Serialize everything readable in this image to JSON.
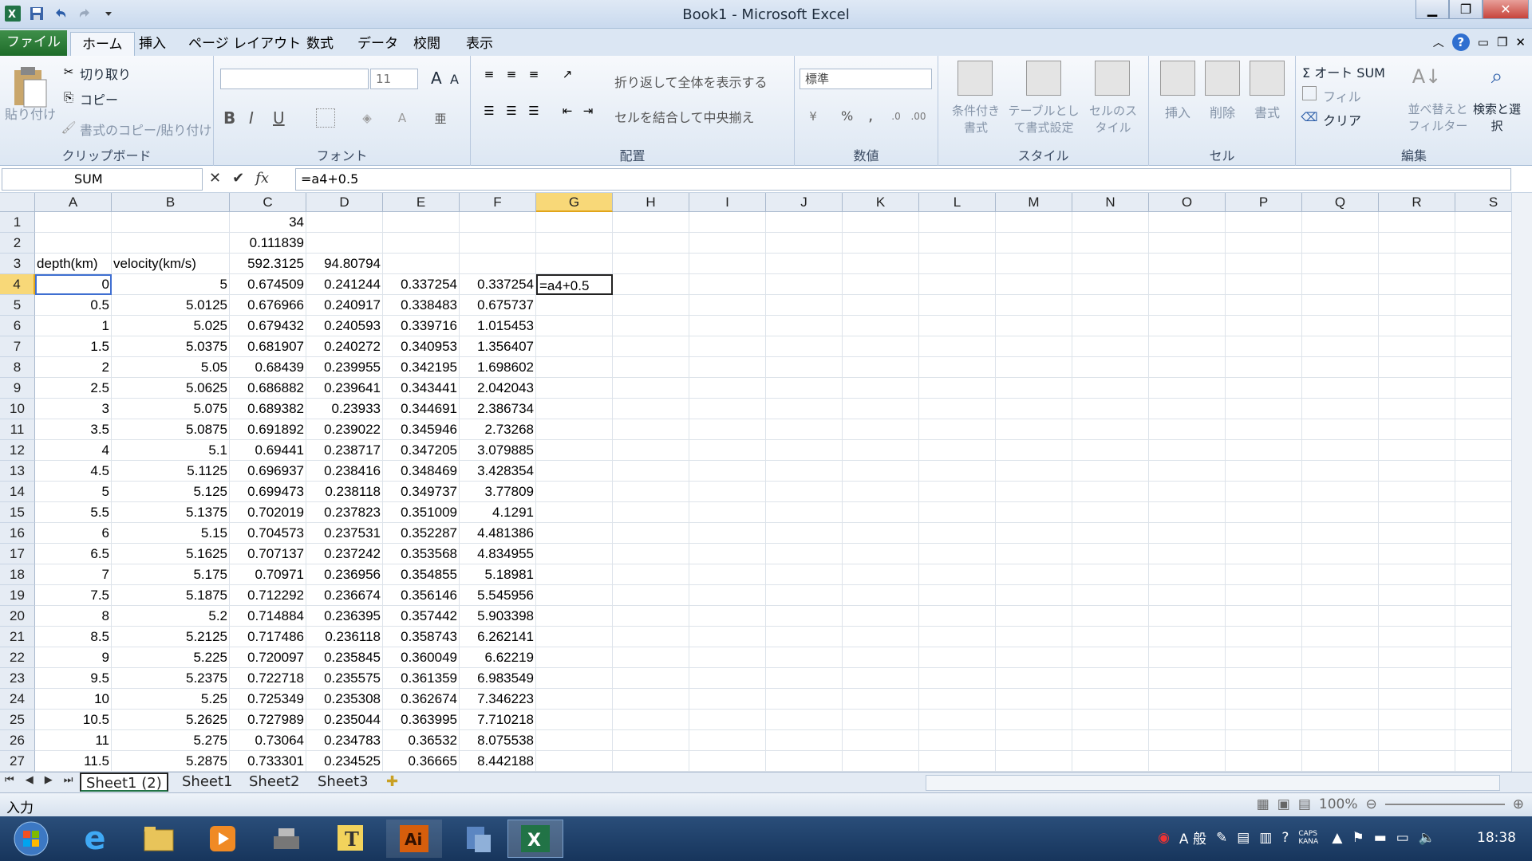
{
  "window": {
    "title": "Book1 - Microsoft Excel"
  },
  "tabs": [
    "ファイル",
    "ホーム",
    "挿入",
    "ページ レイアウト",
    "数式",
    "データ",
    "校閲",
    "表示"
  ],
  "ribbon": {
    "clipboard": {
      "paste": "貼り付け",
      "cut": "切り取り",
      "copy": "コピー",
      "format_painter": "書式のコピー/貼り付け",
      "label": "クリップボード"
    },
    "font": {
      "font_name": "",
      "font_size": "11",
      "bold": "B",
      "italic": "I",
      "underline": "U",
      "label": "フォント"
    },
    "alignment": {
      "wrap": "折り返して全体を表示する",
      "merge": "セルを結合して中央揃え",
      "label": "配置"
    },
    "number": {
      "format": "標準",
      "percent": "%",
      "comma": ",",
      "label": "数値"
    },
    "styles": {
      "conditional": "条件付き書式",
      "table": "テーブルとして書式設定",
      "cell": "セルのスタイル",
      "label": "スタイル"
    },
    "cells": {
      "insert": "挿入",
      "delete": "削除",
      "format": "書式",
      "label": "セル"
    },
    "editing": {
      "autosum": "Σ オート SUM",
      "fill": "フィル",
      "clear": "クリア",
      "sort": "並べ替えとフィルター",
      "find": "検索と選択",
      "label": "編集"
    }
  },
  "formula_bar": {
    "name_box": "SUM",
    "fx": "fx",
    "formula": "=a4+0.5"
  },
  "columns": [
    "A",
    "B",
    "C",
    "D",
    "E",
    "F",
    "G",
    "H",
    "I",
    "J",
    "K",
    "L",
    "M",
    "N",
    "O",
    "P",
    "Q",
    "R",
    "S"
  ],
  "rows": [
    {
      "n": "1",
      "c": [
        "",
        "",
        "34",
        "",
        "",
        "",
        ""
      ]
    },
    {
      "n": "2",
      "c": [
        "",
        "",
        "0.111839",
        "",
        "",
        "",
        ""
      ]
    },
    {
      "n": "3",
      "c": [
        "depth(km)",
        "velocity(km/s)",
        "592.3125",
        "94.80794",
        "",
        "",
        ""
      ]
    },
    {
      "n": "4",
      "c": [
        "0",
        "5",
        "0.674509",
        "0.241244",
        "0.337254",
        "0.337254",
        "=a4+0.5"
      ]
    },
    {
      "n": "5",
      "c": [
        "0.5",
        "5.0125",
        "0.676966",
        "0.240917",
        "0.338483",
        "0.675737",
        ""
      ]
    },
    {
      "n": "6",
      "c": [
        "1",
        "5.025",
        "0.679432",
        "0.240593",
        "0.339716",
        "1.015453",
        ""
      ]
    },
    {
      "n": "7",
      "c": [
        "1.5",
        "5.0375",
        "0.681907",
        "0.240272",
        "0.340953",
        "1.356407",
        ""
      ]
    },
    {
      "n": "8",
      "c": [
        "2",
        "5.05",
        "0.68439",
        "0.239955",
        "0.342195",
        "1.698602",
        ""
      ]
    },
    {
      "n": "9",
      "c": [
        "2.5",
        "5.0625",
        "0.686882",
        "0.239641",
        "0.343441",
        "2.042043",
        ""
      ]
    },
    {
      "n": "10",
      "c": [
        "3",
        "5.075",
        "0.689382",
        "0.23933",
        "0.344691",
        "2.386734",
        ""
      ]
    },
    {
      "n": "11",
      "c": [
        "3.5",
        "5.0875",
        "0.691892",
        "0.239022",
        "0.345946",
        "2.73268",
        ""
      ]
    },
    {
      "n": "12",
      "c": [
        "4",
        "5.1",
        "0.69441",
        "0.238717",
        "0.347205",
        "3.079885",
        ""
      ]
    },
    {
      "n": "13",
      "c": [
        "4.5",
        "5.1125",
        "0.696937",
        "0.238416",
        "0.348469",
        "3.428354",
        ""
      ]
    },
    {
      "n": "14",
      "c": [
        "5",
        "5.125",
        "0.699473",
        "0.238118",
        "0.349737",
        "3.77809",
        ""
      ]
    },
    {
      "n": "15",
      "c": [
        "5.5",
        "5.1375",
        "0.702019",
        "0.237823",
        "0.351009",
        "4.1291",
        ""
      ]
    },
    {
      "n": "16",
      "c": [
        "6",
        "5.15",
        "0.704573",
        "0.237531",
        "0.352287",
        "4.481386",
        ""
      ]
    },
    {
      "n": "17",
      "c": [
        "6.5",
        "5.1625",
        "0.707137",
        "0.237242",
        "0.353568",
        "4.834955",
        ""
      ]
    },
    {
      "n": "18",
      "c": [
        "7",
        "5.175",
        "0.70971",
        "0.236956",
        "0.354855",
        "5.18981",
        ""
      ]
    },
    {
      "n": "19",
      "c": [
        "7.5",
        "5.1875",
        "0.712292",
        "0.236674",
        "0.356146",
        "5.545956",
        ""
      ]
    },
    {
      "n": "20",
      "c": [
        "8",
        "5.2",
        "0.714884",
        "0.236395",
        "0.357442",
        "5.903398",
        ""
      ]
    },
    {
      "n": "21",
      "c": [
        "8.5",
        "5.2125",
        "0.717486",
        "0.236118",
        "0.358743",
        "6.262141",
        ""
      ]
    },
    {
      "n": "22",
      "c": [
        "9",
        "5.225",
        "0.720097",
        "0.235845",
        "0.360049",
        "6.62219",
        ""
      ]
    },
    {
      "n": "23",
      "c": [
        "9.5",
        "5.2375",
        "0.722718",
        "0.235575",
        "0.361359",
        "6.983549",
        ""
      ]
    },
    {
      "n": "24",
      "c": [
        "10",
        "5.25",
        "0.725349",
        "0.235308",
        "0.362674",
        "7.346223",
        ""
      ]
    },
    {
      "n": "25",
      "c": [
        "10.5",
        "5.2625",
        "0.727989",
        "0.235044",
        "0.363995",
        "7.710218",
        ""
      ]
    },
    {
      "n": "26",
      "c": [
        "11",
        "5.275",
        "0.73064",
        "0.234783",
        "0.36532",
        "8.075538",
        ""
      ]
    },
    {
      "n": "27",
      "c": [
        "11.5",
        "5.2875",
        "0.733301",
        "0.234525",
        "0.36665",
        "8.442188",
        ""
      ]
    }
  ],
  "sheets": [
    "Sheet1 (2)",
    "Sheet1",
    "Sheet2",
    "Sheet3"
  ],
  "status": {
    "mode": "入力",
    "zoom": "100%"
  },
  "taskbar": {
    "ime": "A 般",
    "caps": "CAPS KANA",
    "clock": "18:38"
  },
  "colors": {
    "excel_green": "#217346",
    "selection_yellow": "#f8d878",
    "taskbar": "#1d3f69"
  }
}
